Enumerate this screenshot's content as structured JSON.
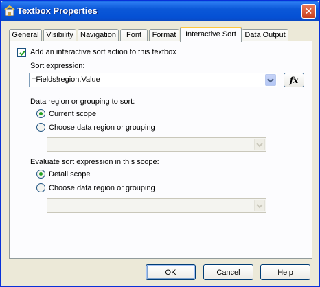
{
  "window": {
    "title": "Textbox Properties",
    "close_symbol": "✕"
  },
  "tabs": [
    {
      "label": "General"
    },
    {
      "label": "Visibility"
    },
    {
      "label": "Navigation"
    },
    {
      "label": "Font"
    },
    {
      "label": "Format"
    },
    {
      "label": "Interactive Sort",
      "active": true
    },
    {
      "label": "Data Output"
    }
  ],
  "interactive_sort": {
    "add_action_label": "Add an interactive sort action to this textbox",
    "add_action_checked": true,
    "sort_expression_label": "Sort expression:",
    "sort_expression_value": "=Fields!region.Value",
    "fx_label": "fx",
    "data_region_label": "Data region or grouping to sort:",
    "data_region_options": {
      "current_scope": "Current scope",
      "choose": "Choose data region or grouping",
      "selected": "current_scope"
    },
    "data_region_combo_value": "",
    "evaluate_label": "Evaluate sort expression in this scope:",
    "evaluate_options": {
      "detail_scope": "Detail scope",
      "choose": "Choose data region or grouping",
      "selected": "detail_scope"
    },
    "evaluate_combo_value": ""
  },
  "buttons": {
    "ok": "OK",
    "cancel": "Cancel",
    "help": "Help"
  }
}
